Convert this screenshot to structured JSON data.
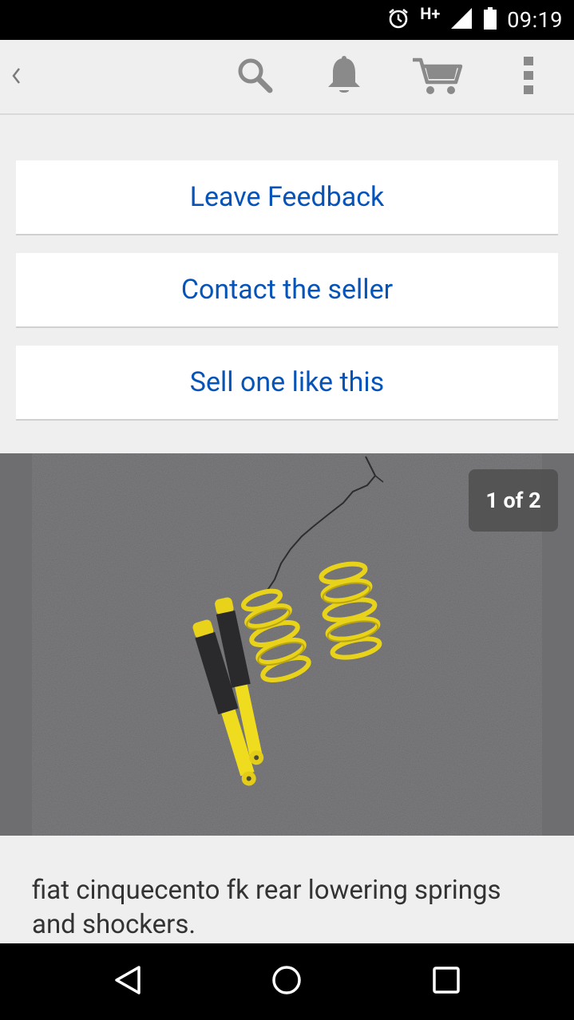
{
  "status_bar": {
    "network": "H+",
    "time": "09:19"
  },
  "toolbar": {
    "back_icon": "chevron-left-icon",
    "icons": [
      "search-icon",
      "bell-icon",
      "cart-icon",
      "overflow-menu-icon"
    ]
  },
  "actions": {
    "leave_feedback": "Leave Feedback",
    "contact_seller": "Contact the seller",
    "sell_one_like_this": "Sell one like this"
  },
  "gallery": {
    "counter": "1 of 2"
  },
  "item": {
    "title": "fiat cinquecento fk rear lowering springs and shockers."
  },
  "nav_bar": {
    "icons": [
      "back-triangle-icon",
      "home-circle-icon",
      "recents-square-icon"
    ]
  },
  "colors": {
    "link": "#0654ba",
    "background": "#efefef",
    "spring_yellow": "#e8d21a"
  }
}
